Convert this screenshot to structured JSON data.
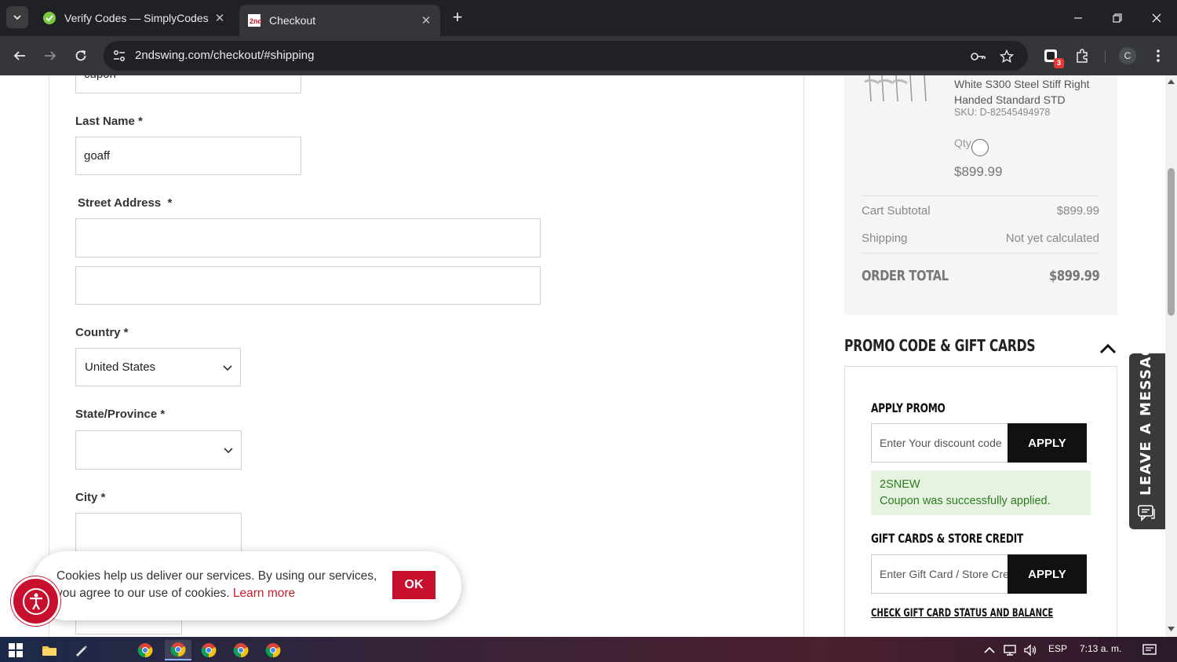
{
  "browser": {
    "tabs": [
      {
        "title": "Verify Codes — SimplyCodes",
        "active": false
      },
      {
        "title": "Checkout",
        "active": true
      }
    ],
    "url": "2ndswing.com/checkout/#shipping",
    "profile_initial": "C",
    "extension_badge": "3"
  },
  "form": {
    "first_name_value": "cupon",
    "last_name_label": "Last Name",
    "last_name_value": "goaff",
    "street_label": "Street Address",
    "country_label": "Country",
    "country_value": "United States",
    "state_label": "State/Province",
    "city_label": "City",
    "required_mark": "*"
  },
  "summary": {
    "product_name": "White S300 Steel Stiff Right Handed Standard STD",
    "sku": "SKU: D-82545494978",
    "qty_label": "Qty",
    "price": "$899.99",
    "cart_subtotal_label": "Cart Subtotal",
    "cart_subtotal_value": "$899.99",
    "shipping_label": "Shipping",
    "shipping_value": "Not yet calculated",
    "order_total_label": "ORDER TOTAL",
    "order_total_value": "$899.99"
  },
  "promo": {
    "title": "PROMO CODE & GIFT CARDS",
    "apply_promo_title": "APPLY PROMO",
    "promo_placeholder": "Enter Your discount code",
    "apply_label": "APPLY",
    "applied_code": "2SNEW",
    "applied_message": "Coupon was successfully applied.",
    "gift_title": "GIFT CARDS & STORE CREDIT",
    "gift_placeholder": "Enter Gift Card / Store Cre",
    "gift_apply_label": "APPLY",
    "gift_link": "CHECK GIFT CARD STATUS AND BALANCE"
  },
  "chat": {
    "label": "LEAVE A MESSAGE"
  },
  "cookie": {
    "text": "Cookies help us deliver our services. By using our services, you agree to our use of cookies.",
    "learn_more": "Learn more",
    "ok_label": "OK"
  },
  "taskbar": {
    "language": "ESP",
    "time": "7:13 a. m."
  },
  "colors": {
    "brand_red": "#c8102e",
    "success_bg": "#e5f3e0",
    "success_text": "#2d7a1f",
    "chrome_dark": "#202124"
  }
}
